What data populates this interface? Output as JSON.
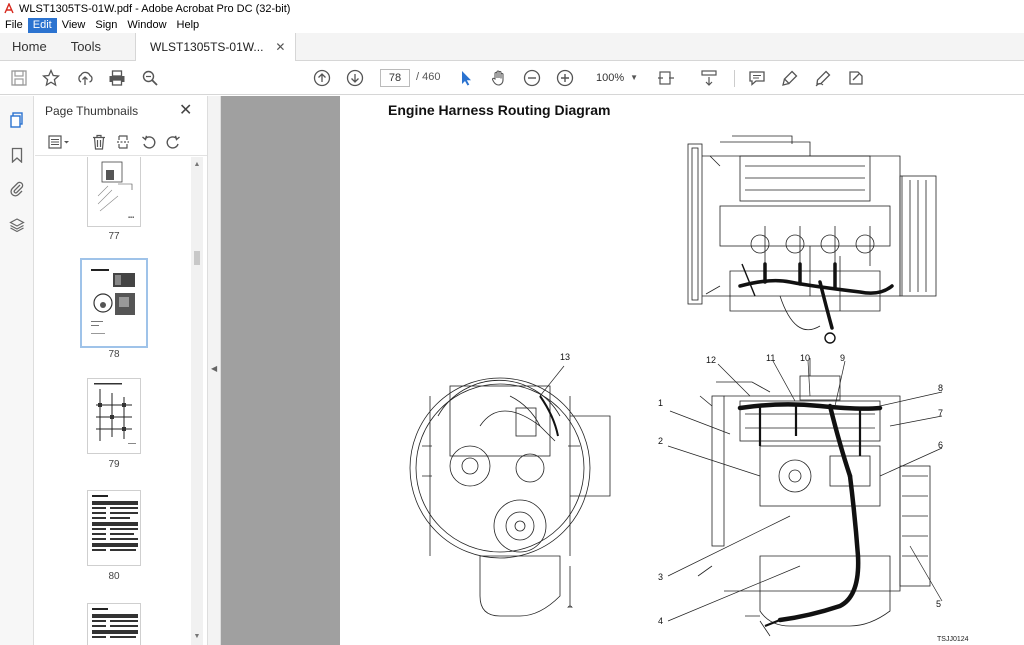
{
  "window": {
    "title": "WLST1305TS-01W.pdf - Adobe Acrobat Pro DC (32-bit)"
  },
  "menu": [
    "File",
    "Edit",
    "View",
    "Sign",
    "Window",
    "Help"
  ],
  "tabs": {
    "home": "Home",
    "tools": "Tools",
    "document": "WLST1305TS-01W..."
  },
  "toolbar": {
    "current_page": "78",
    "page_separator": "/  460",
    "zoom": "100%"
  },
  "thumbnails": {
    "panel_title": "Page Thumbnails",
    "pages": [
      "77",
      "78",
      "79",
      "80"
    ],
    "selected": "78"
  },
  "document": {
    "heading": "Engine Harness Routing Diagram",
    "figure_code": "TSJJ0124",
    "callouts": [
      "1",
      "2",
      "3",
      "4",
      "5",
      "6",
      "7",
      "8",
      "9",
      "10",
      "11",
      "12",
      "13"
    ]
  },
  "icons": {
    "save": "save-icon",
    "star": "bookmark-star-icon",
    "upload": "share-upload-icon",
    "print": "print-icon",
    "search": "search-zoom-icon"
  }
}
